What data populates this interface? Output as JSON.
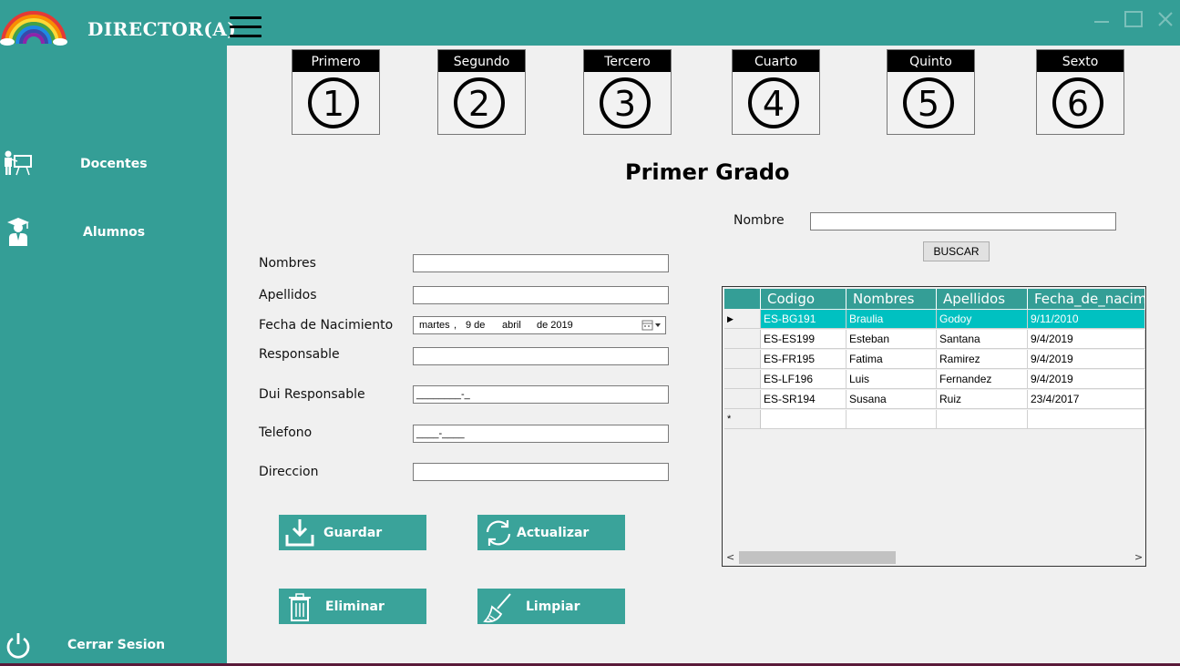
{
  "app": {
    "title": "DIRECTOR(A)"
  },
  "sidebar": {
    "items": [
      {
        "label": "Docentes",
        "icon": "teacher-icon"
      },
      {
        "label": "Alumnos",
        "icon": "student-icon"
      }
    ],
    "logout": {
      "label": "Cerrar Sesion",
      "icon": "power-icon"
    }
  },
  "grades": [
    {
      "label": "Primero",
      "number": "1"
    },
    {
      "label": "Segundo",
      "number": "2"
    },
    {
      "label": "Tercero",
      "number": "3"
    },
    {
      "label": "Cuarto",
      "number": "4"
    },
    {
      "label": "Quinto",
      "number": "5"
    },
    {
      "label": "Sexto",
      "number": "6"
    }
  ],
  "page": {
    "title": "Primer Grado"
  },
  "form": {
    "nombres_label": "Nombres",
    "apellidos_label": "Apellidos",
    "fecha_label": "Fecha de Nacimiento",
    "fecha_value": {
      "weekday": "martes",
      "sep": ",",
      "day": "9 de",
      "month": "abril",
      "year": "de 2019"
    },
    "responsable_label": "Responsable",
    "dui_label": "Dui Responsable",
    "dui_mask": "________-_",
    "telefono_label": "Telefono",
    "telefono_mask": "____-____",
    "direccion_label": "Direccion"
  },
  "actions": {
    "guardar": "Guardar",
    "actualizar": "Actualizar",
    "eliminar": "Eliminar",
    "limpiar": "Limpiar"
  },
  "search": {
    "label": "Nombre",
    "button": "BUSCAR"
  },
  "grid": {
    "columns": [
      "Codigo",
      "Nombres",
      "Apellidos",
      "Fecha_de_nacim"
    ],
    "rows": [
      [
        "ES-BG191",
        "Braulia",
        "Godoy",
        "9/11/2010"
      ],
      [
        "ES-ES199",
        "Esteban",
        "Santana",
        "9/4/2019"
      ],
      [
        "ES-FR195",
        "Fatima",
        "Ramirez",
        "9/4/2019"
      ],
      [
        "ES-LF196",
        "Luis",
        "Fernandez",
        "9/4/2019"
      ],
      [
        "ES-SR194",
        "Susana",
        "Ruiz",
        "23/4/2017"
      ]
    ],
    "selected_marker": "▶",
    "new_row_marker": "*"
  },
  "colors": {
    "teal": "#349e96",
    "selected_row": "#00c1c1",
    "header_black": "#000000"
  }
}
